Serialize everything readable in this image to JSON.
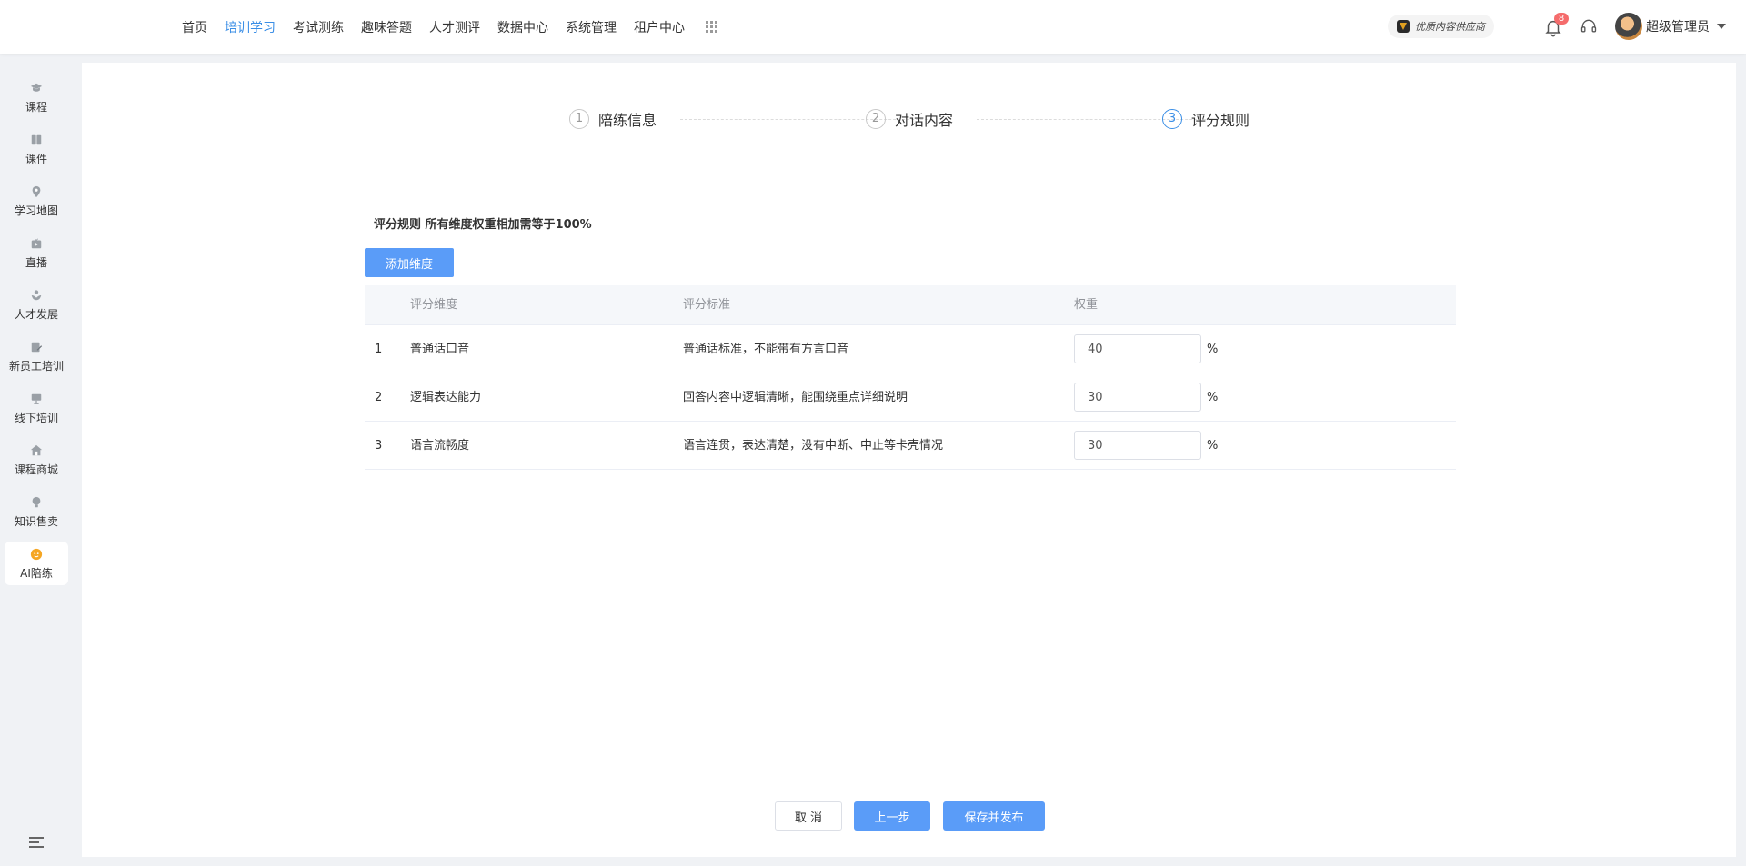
{
  "nav": {
    "items": [
      "首页",
      "培训学习",
      "考试测练",
      "趣味答题",
      "人才测评",
      "数据中心",
      "系统管理",
      "租户中心"
    ],
    "active_index": 1
  },
  "header": {
    "supplier_badge": "优质内容供应商",
    "notification_count": "8",
    "username": "超级管理员"
  },
  "sidebar": {
    "items": [
      {
        "label": "课程",
        "icon": "graduation-cap-icon"
      },
      {
        "label": "课件",
        "icon": "book-icon"
      },
      {
        "label": "学习地图",
        "icon": "map-pin-icon"
      },
      {
        "label": "直播",
        "icon": "live-tv-icon"
      },
      {
        "label": "人才发展",
        "icon": "growth-icon"
      },
      {
        "label": "新员工培训",
        "icon": "edit-icon"
      },
      {
        "label": "线下培训",
        "icon": "presentation-icon"
      },
      {
        "label": "课程商城",
        "icon": "store-icon"
      },
      {
        "label": "知识售卖",
        "icon": "lightbulb-icon"
      },
      {
        "label": "AI陪练",
        "icon": "ai-coach-icon"
      }
    ],
    "active_index": 9
  },
  "steps": [
    {
      "number": "1",
      "label": "陪练信息"
    },
    {
      "number": "2",
      "label": "对话内容"
    },
    {
      "number": "3",
      "label": "评分规则"
    }
  ],
  "active_step": 2,
  "rules": {
    "title": "评分规则 所有维度权重相加需等于100%",
    "add_button": "添加维度",
    "columns": [
      "评分维度",
      "评分标准",
      "权重"
    ],
    "rows": [
      {
        "index": "1",
        "dimension": "普通话口音",
        "standard": "普通话标准，不能带有方言口音",
        "weight": "40",
        "unit": "%"
      },
      {
        "index": "2",
        "dimension": "逻辑表达能力",
        "standard": "回答内容中逻辑清晰，能围绕重点详细说明",
        "weight": "30",
        "unit": "%"
      },
      {
        "index": "3",
        "dimension": "语言流畅度",
        "standard": "语言连贯，表达清楚，没有中断、中止等卡壳情况",
        "weight": "30",
        "unit": "%"
      }
    ]
  },
  "footer": {
    "cancel": "取 消",
    "prev": "上一步",
    "save": "保存并发布"
  },
  "colors": {
    "accent": "#3a8ee6",
    "primary_button": "#5a9cf8",
    "badge": "#f56c6c",
    "ai_icon": "#f5a623"
  }
}
